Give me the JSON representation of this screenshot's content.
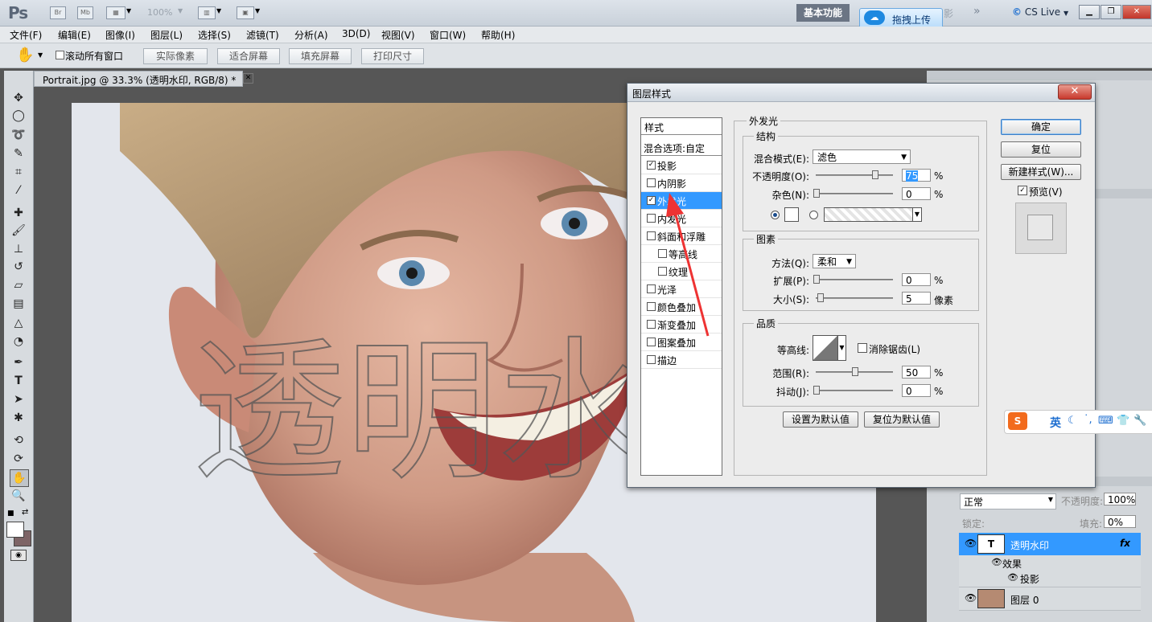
{
  "app": {
    "logo": "Ps",
    "zoom": "100%",
    "workspace": "基本功能",
    "upload_label": "拖拽上传",
    "cs_live": "CS Live",
    "hidden_label": "影",
    "win_min": "▁",
    "win_max": "❐",
    "win_close": "✕"
  },
  "menu": [
    "文件(F)",
    "编辑(E)",
    "图像(I)",
    "图层(L)",
    "选择(S)",
    "滤镜(T)",
    "分析(A)",
    "3D(D)",
    "视图(V)",
    "窗口(W)",
    "帮助(H)"
  ],
  "options": {
    "scroll_all_label": "滚动所有窗口",
    "buttons": [
      "实际像素",
      "适合屏幕",
      "填充屏幕",
      "打印尺寸"
    ]
  },
  "document": {
    "tab_title": "Portrait.jpg @ 33.3% (透明水印, RGB/8) *",
    "watermark_text": "透明水印"
  },
  "dialog": {
    "title": "图层样式",
    "style_header": "样式",
    "blend_options": "混合选项:自定",
    "styles": [
      {
        "label": "投影",
        "checked": true,
        "sub": false,
        "selected": false
      },
      {
        "label": "内阴影",
        "checked": false,
        "sub": false,
        "selected": false
      },
      {
        "label": "外发光",
        "checked": true,
        "sub": false,
        "selected": true
      },
      {
        "label": "内发光",
        "checked": false,
        "sub": false,
        "selected": false
      },
      {
        "label": "斜面和浮雕",
        "checked": false,
        "sub": false,
        "selected": false
      },
      {
        "label": "等高线",
        "checked": false,
        "sub": true,
        "selected": false
      },
      {
        "label": "纹理",
        "checked": false,
        "sub": true,
        "selected": false
      },
      {
        "label": "光泽",
        "checked": false,
        "sub": false,
        "selected": false
      },
      {
        "label": "颜色叠加",
        "checked": false,
        "sub": false,
        "selected": false
      },
      {
        "label": "渐变叠加",
        "checked": false,
        "sub": false,
        "selected": false
      },
      {
        "label": "图案叠加",
        "checked": false,
        "sub": false,
        "selected": false
      },
      {
        "label": "描边",
        "checked": false,
        "sub": false,
        "selected": false
      }
    ],
    "section_title": "外发光",
    "structure": {
      "title": "结构",
      "blend_mode_label": "混合模式(E):",
      "blend_mode": "滤色",
      "opacity_label": "不透明度(O):",
      "opacity": "75",
      "noise_label": "杂色(N):",
      "noise": "0",
      "percent": "%"
    },
    "elements": {
      "title": "图素",
      "technique_label": "方法(Q):",
      "technique": "柔和",
      "spread_label": "扩展(P):",
      "spread": "0",
      "size_label": "大小(S):",
      "size": "5",
      "size_unit": "像素"
    },
    "quality": {
      "title": "品质",
      "contour_label": "等高线:",
      "antialias_label": "消除锯齿(L)",
      "range_label": "范围(R):",
      "range": "50",
      "jitter_label": "抖动(J):",
      "jitter": "0"
    },
    "make_default": "设置为默认值",
    "reset_default": "复位为默认值",
    "ok": "确定",
    "reset": "复位",
    "new_style": "新建样式(W)...",
    "preview_label": "预览(V)"
  },
  "layers": {
    "mode": "正常",
    "opacity_label": "不透明度:",
    "opacity": "100%",
    "lock_label": "锁定:",
    "fill_label": "填充:",
    "fill": "0%",
    "rows": {
      "text_layer": "透明水印",
      "fx": "fx",
      "effects": "效果",
      "drop_shadow": "投影",
      "bg_layer": "图层 0"
    }
  },
  "ime": {
    "mode": "英"
  },
  "colors": {
    "selection": "#3399ff",
    "arrow": "#ee3333",
    "accent": "#1e89e0"
  }
}
